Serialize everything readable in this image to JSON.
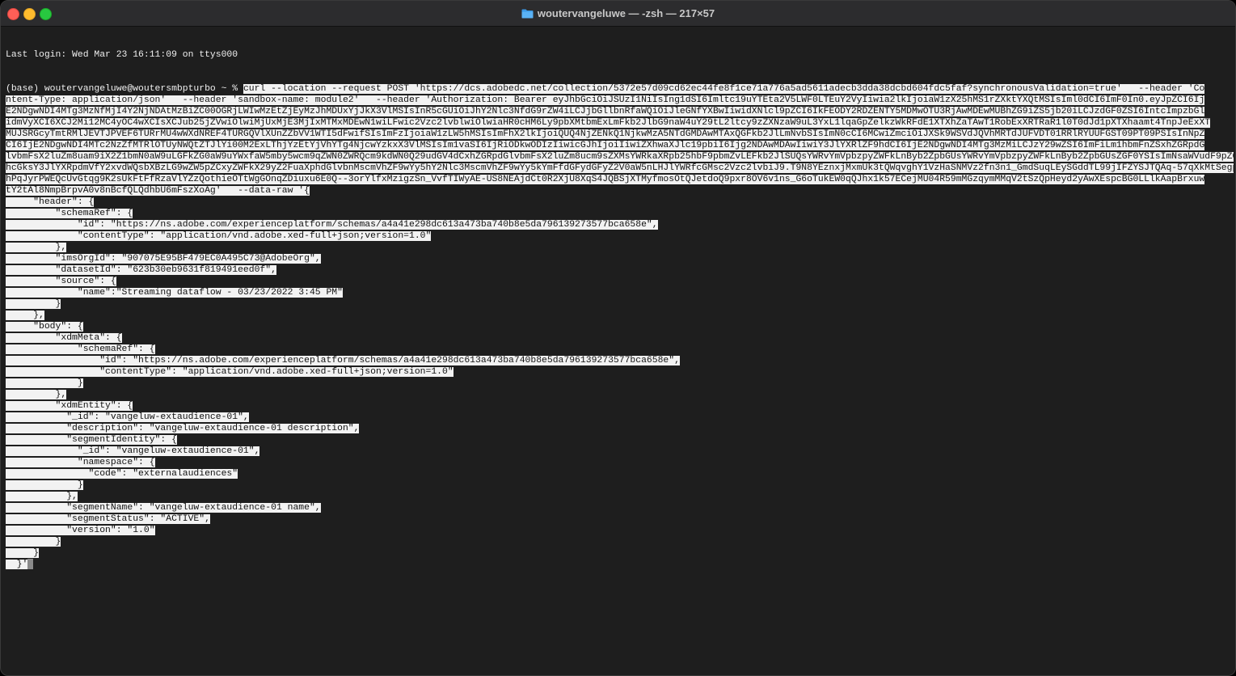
{
  "window": {
    "title": "woutervangeluwe — -zsh — 217×57",
    "folder_icon": "folder-icon"
  },
  "terminal": {
    "login_line": "Last login: Wed Mar 23 16:11:09 on ttys000",
    "prompt": "(base) woutervangeluwe@woutersmbpturbo ~ % ",
    "command_lines": [
      "curl --location --request POST 'https://dcs.adobedc.net/collection/5372e57d09cd62ec44fe8f1ce71a776a5ad5611adecb3dda38dcbd604fdc5faf?synchronousValidation=true'   --header 'Co",
      "ntent-Type: application/json'   --header 'sandbox-name: module2'   --header 'Authorization: Bearer eyJhbGciOiJSUzI1NiIsIng1dSI6Imltc19uYTEta2V5LWF0LTEuY2VyIiwia2lkIjoiaW1zX25hMS1rZXktYXQtMSIsIml0dCI6ImF0In0.eyJpZCI6Ij",
      "E2NDgwNDI4MTg3MzNfMjI4Y2NjNDAtMzBiZC00OGRjLWIwMzEtZjEyMzJhMDUxYjJkX3VlMSIsInR5cGUiOiJhY2Nlc3NfdG9rZW4iLCJjbGllbnRfaWQiOiJleGNfYXBwIiwidXNlcl9pZCI6IkFEODY2RDZENTY5MDMwOTU3RjAwMDEwMUBhZG9iZS5jb20iLCJzdGF0ZSI6IntcImpzbGl",
      "idmVyXCI6XCJ2Mi12MC4yOC4wXCIsXCJub25jZVwiOlwiMjUxMjE3MjIxMTMxMDEwN1wiLFwic2Vzc2lvblwiOlwiaHR0cHM6Ly9pbXMtbmExLmFkb2JlbG9naW4uY29tL2ltcy9zZXNzaW9uL3YxL1lqaGpZelkzWkRFdE1XTXhZaTAwT1RobExXRTRaR1l0T0dJd1pXTXhaamt4TnpJeExXT",
      "MUJSRGcyTmtRMlJEVTJPVEF6TURrMU4wWXdNREF4TURGQVlXUnZZbVV1WTI5dFwifSIsImFzIjoiaW1zLW5hMSIsImFhX2lkIjoiQUQ4NjZENkQ1NjkwMzA5NTdGMDAwMTAxQGFkb2JlLmNvbSIsImN0cCI6MCwiZmciOiJXSk9WSVdJQVhMRTdJUFVDT01RRlRYUUFGST09PT09PSIsInNpZ",
      "CI6IjE2NDgwNDI4MTc2NzZfMTRlOTUyNWQtZTJlYi00M2ExLThjYzEtYjVhYTg4NjcwYzkxX3VlMSIsIm1vaSI6IjRiODkwODIzIiwicGJhIjoiIiwiZXhwaXJlc19pbiI6Ijg2NDAwMDAwIiwiY3JlYXRlZF9hdCI6IjE2NDgwNDI4MTg3MzMiLCJzY29wZSI6ImFiLm1hbmFnZSxhZGRpdG",
      "lvbmFsX2luZm8uam9iX2Z1bmN0aW9uLGFkZG0aW9uYWxfaW5mby5wcm9qZWN0ZWRQcm9kdWN0Q29udGV4dCxhZGRpdGlvbmFsX2luZm8ucm9sZXMsYWRkaXRpb25hbF9pbmZvLEFkb2JlSUQsYWRvYmVpbzpyZWFkLnByb2ZpbGUsYWRvYmVpbzpyZWFkLnByb2ZpbGUsZGF0YSIsImNsaWVudF9pZCI6",
      "hcGksY3JlYXRpdmVfY2xvdWQsbXBzLG9wZW5pZCxyZWFkX29yZ2FuaXphdGlvbnMscmVhZF9wYy5hY2Nlc3MscmVhZF9wYy5kYmFfdGFydGFyZ2V0aW5nLHJlYWRfcGMsc2Vzc2lvbiJ9.T9N8YEznxjMxmUk3tQWqvghY1VzHaSNMVz2fn3n1_GmdSuqLEySGddTL99jIFZYSJTQAq-57qXkMtSegplmdBFe",
      "hPqJyrPWEQcUvGtqg9K2sUkFtFfRzaVlYZzQothieOTtWgGOnqZDiuxu6E0Q--3orYlfxMzigzSn_VvfTIWyAE-US8NEAjdCt0R2XjU8XqS4JQBSjXTMyfmosOtQJetdoQ9pxr8OV6v1ns_G6oTukEW0qQJhx1k57ECejMU04R59mMGzqymMMqV2tSzQpHeyd2yAwXEspcBG0LLlkAapBrxuw",
      "tY2tAl8NmpBrpvA0v8nBcfQLQdhbU6mFszXoAg'   --data-raw '{"
    ],
    "json_lines": [
      "     \"header\": {",
      "         \"schemaRef\": {",
      "             \"id\": \"https://ns.adobe.com/experienceplatform/schemas/a4a41e298dc613a473ba740b8e5da796139273577bca658e\",",
      "             \"contentType\": \"application/vnd.adobe.xed-full+json;version=1.0\"",
      "         },",
      "         \"imsOrgId\": \"907075E95BF479EC0A495C73@AdobeOrg\",",
      "         \"datasetId\": \"623b30eb9631f819491eed0f\",",
      "         \"source\": {",
      "             \"name\":\"Streaming dataflow - 03/23/2022 3:45 PM\"",
      "         }",
      "     },",
      "     \"body\": {",
      "         \"xdmMeta\": {",
      "             \"schemaRef\": {",
      "                 \"id\": \"https://ns.adobe.com/experienceplatform/schemas/a4a41e298dc613a473ba740b8e5da796139273577bca658e\",",
      "                 \"contentType\": \"application/vnd.adobe.xed-full+json;version=1.0\"",
      "             }",
      "         },",
      "         \"xdmEntity\": {",
      "           \"_id\": \"vangeluw-extaudience-01\",",
      "           \"description\": \"vangeluw-extaudience-01 description\",",
      "           \"segmentIdentity\": {",
      "             \"_id\": \"vangeluw-extaudience-01\",",
      "             \"namespace\": {",
      "               \"code\": \"externalaudiences\"",
      "             }",
      "           },",
      "           \"segmentName\": \"vangeluw-extaudience-01 name\",",
      "           \"segmentStatus\": \"ACTIVE\",",
      "           \"version\": \"1.0\"",
      "         }",
      "     }",
      "  }'"
    ]
  }
}
